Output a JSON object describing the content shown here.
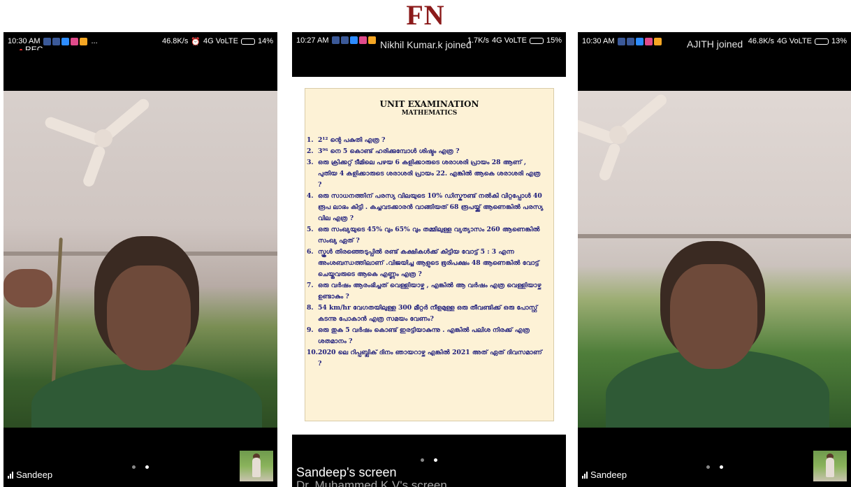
{
  "logo": "FN",
  "left": {
    "status": {
      "time": "10:30 AM",
      "dots": "...",
      "speed": "46.8K/s",
      "network": "4G VoLTE",
      "battery": "14%"
    },
    "rec_label": "REC",
    "participant": "Sandeep"
  },
  "middle": {
    "status": {
      "time": "10:27 AM",
      "speed": "1.7K/s",
      "network": "4G VoLTE",
      "battery": "15%"
    },
    "toast": "Nikhil Kumar.k joined",
    "document": {
      "title": "UNIT EXAMINATION",
      "subtitle": "MATHEMATICS",
      "questions": [
        {
          "num": "1.",
          "text": "2¹² ന്റെ പകുതി എത്ര ?"
        },
        {
          "num": "2.",
          "text": "3⁹⁶ നെ 5 കൊണ്ട് ഹരിക്കുമ്പോൾ ശിഷ്ടം എത്ര ?"
        },
        {
          "num": "3.",
          "text": "ഒരു ക്രിക്കറ്റ് ടീമിലെ പഴയ 6 കളിക്കാരുടെ ശരാശരി പ്രായം 28 ആണ് , പുതിയ 4 കളിക്കാരുടെ ശരാശരി പ്രായം 22. എങ്കിൽ ആകെ ശരാശരി എത്ര ?"
        },
        {
          "num": "4.",
          "text": "ഒരു സാധനത്തിന് പരസ്യ വിലയുടെ 10% ഡിസ്കൗണ്ട് നൽകി വിറ്റപ്പോൾ 40 രൂപ ലാഭം കിട്ടി . കച്ചവടക്കാരൻ വാങ്ങിയത് 68 രൂപയ്ക്ക് ആണെങ്കിൽ പരസ്യ വില എത്ര ?"
        },
        {
          "num": "5.",
          "text": "ഒരു സംഖ്യയുടെ 45% വും 65% വും തമ്മിലുള്ള വ്യത്യാസം 260 ആണെങ്കിൽ സംഖ്യ ഏത് ?"
        },
        {
          "num": "6.",
          "text": "സ്കൂൾ തിരഞ്ഞെടുപ്പിൽ രണ്ട് കക്ഷികൾക്ക് കിട്ടിയ വോട്ട് 5 : 3 എന്ന അംശബന്ധത്തിലാണ് .വിജയിച്ച ആളുടെ ഭൂരിപക്ഷം 48 ആണെങ്കിൽ വോട്ട് ചെയ്തവരുടെ ആകെ എണ്ണം എത്ര ?"
        },
        {
          "num": "7.",
          "text": "ഒരു വർഷം ആരംഭിച്ചത് വെള്ളിയാഴ്ച , എങ്കിൽ ആ വർഷം എത്ര വെള്ളിയാഴ്ച ഉണ്ടാകും ?"
        },
        {
          "num": "8.",
          "text": "54 km/hr വേഗതയിലുള്ള 300 മീറ്റർ നീളമുള്ള ഒരു തീവണ്ടിക്ക് ഒരു പോസ്റ്റ് കടന്നു പോകാൻ എത്ര സമയം വേണം?"
        },
        {
          "num": "9.",
          "text": "ഒരു തുക 5 വർഷം കൊണ്ട് ഇരട്ടിയാകുന്നു . എങ്കിൽ പലിശ നിരക്ക് എത്ര ശതമാനം ?"
        },
        {
          "num": "10.",
          "text": "2020 ലെ റിപ്പബ്ലിക് ദിനം ഞായറാഴ്ച എങ്കിൽ 2021 അത് ഏത് ദിവസമാണ് ?"
        }
      ]
    },
    "screen_label": "Sandeep's screen",
    "screen_label_ghost": "Dr. Muhammed K V's screen"
  },
  "right": {
    "status": {
      "time": "10:30 AM",
      "speed": "46.8K/s",
      "network": "4G VoLTE",
      "battery": "13%"
    },
    "toast": "AJITH joined",
    "participant": "Sandeep"
  },
  "colors": {
    "logo": "#8b1a1a",
    "rec_dot": "#ff3333",
    "document_bg": "#fdf2d6",
    "question_text": "#1a1a7a"
  }
}
